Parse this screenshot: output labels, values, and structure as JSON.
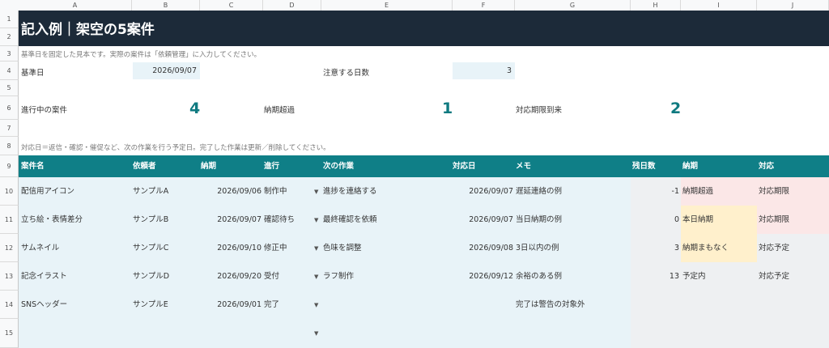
{
  "columns": [
    "A",
    "B",
    "C",
    "D",
    "E",
    "F",
    "G",
    "H",
    "I",
    "J"
  ],
  "rows": [
    "1",
    "2",
    "3",
    "4",
    "5",
    "6",
    "7",
    "8",
    "9",
    "10",
    "11",
    "12",
    "13",
    "14",
    "15"
  ],
  "title": "記入例｜架空の5案件",
  "note_top": "基準日を固定した見本です。実際の案件は「依頼管理」に入力してください。",
  "base_date": {
    "label": "基準日",
    "value": "2026/09/07"
  },
  "warn_days": {
    "label": "注意する日数",
    "value": "3"
  },
  "stats": {
    "in_progress": {
      "label": "進行中の案件",
      "value": "4"
    },
    "overdue": {
      "label": "納期超過",
      "value": "1"
    },
    "due": {
      "label": "対応期限到来",
      "value": "2"
    }
  },
  "note_mid": "対応日＝返信・確認・催促など、次の作業を行う予定日。完了した作業は更新／削除してください。",
  "headers": [
    "案件名",
    "依頼者",
    "納期",
    "進行",
    "次の作業",
    "対応日",
    "メモ",
    "残日数",
    "納期",
    "対応"
  ],
  "colors": {
    "header_bg": "#0f7f87",
    "title_bg": "#1c2a39",
    "input_bg": "#e8f3f8",
    "overdue_bg": "#fbe7e7",
    "soon_bg": "#fff0cc",
    "accent_text": "#0f7a80"
  },
  "table_rows": [
    {
      "name": "配信用アイコン",
      "client": "サンプルA",
      "due": "2026/09/06",
      "progress": "制作中",
      "next": "進捗を連絡する",
      "action_date": "2026/09/07",
      "memo": "遅延連絡の例",
      "days": "-1",
      "due_status": "納期超過",
      "action_status": "対応期限"
    },
    {
      "name": "立ち絵・表情差分",
      "client": "サンプルB",
      "due": "2026/09/07",
      "progress": "確認待ち",
      "next": "最終確認を依頼",
      "action_date": "2026/09/07",
      "memo": "当日納期の例",
      "days": "0",
      "due_status": "本日納期",
      "action_status": "対応期限"
    },
    {
      "name": "サムネイル",
      "client": "サンプルC",
      "due": "2026/09/10",
      "progress": "修正中",
      "next": "色味を調整",
      "action_date": "2026/09/08",
      "memo": "3日以内の例",
      "days": "3",
      "due_status": "納期まもなく",
      "action_status": "対応予定"
    },
    {
      "name": "記念イラスト",
      "client": "サンプルD",
      "due": "2026/09/20",
      "progress": "受付",
      "next": "ラフ制作",
      "action_date": "2026/09/12",
      "memo": "余裕のある例",
      "days": "13",
      "due_status": "予定内",
      "action_status": "対応予定"
    },
    {
      "name": "SNSヘッダー",
      "client": "サンプルE",
      "due": "2026/09/01",
      "progress": "完了",
      "next": "",
      "action_date": "",
      "memo": "完了は警告の対象外",
      "days": "",
      "due_status": "",
      "action_status": ""
    }
  ]
}
